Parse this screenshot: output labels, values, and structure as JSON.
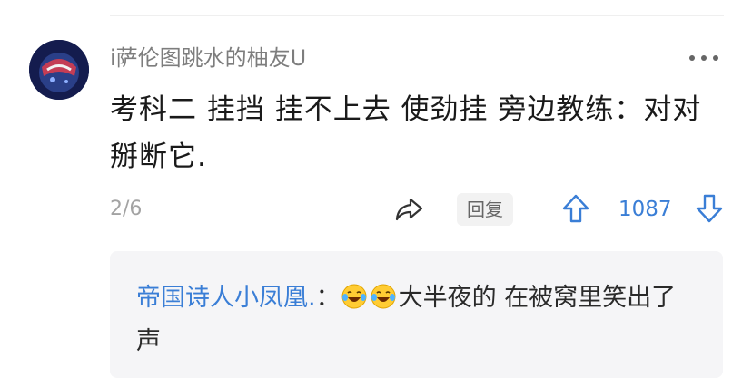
{
  "comment": {
    "username": "i萨伦图跳水的柚友U",
    "text": "考科二 挂挡 挂不上去 使劲挂 旁边教练：对对掰断它.",
    "pager": "2/6",
    "reply_label": "回复",
    "vote_count": "1087"
  },
  "reply": {
    "author": "帝国诗人小凤凰.",
    "separator": "：",
    "emoji_1": "laughing-tears",
    "emoji_2": "laughing-tears",
    "text": "大半夜的 在被窝里笑出了声"
  },
  "colors": {
    "accent_blue": "#3a7ed6",
    "username_gray": "#7d7d7d",
    "reply_bg": "#f5f5f7"
  }
}
